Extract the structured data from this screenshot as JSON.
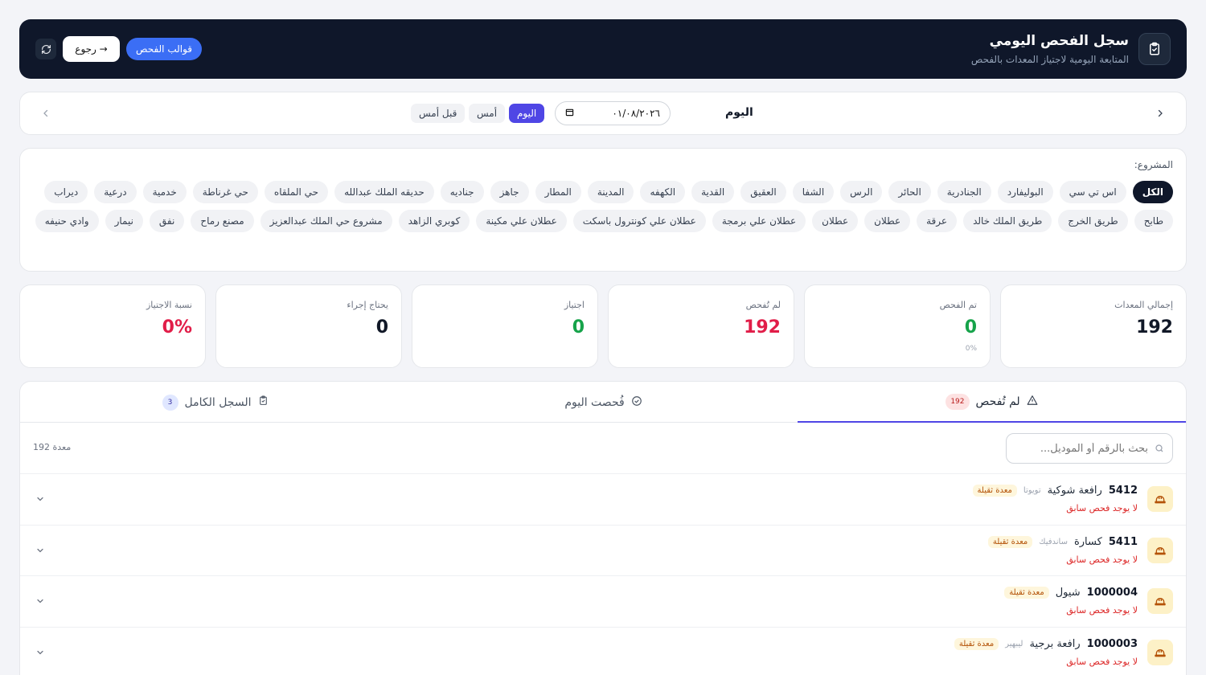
{
  "header": {
    "title": "سجل الفحص اليومي",
    "subtitle": "المتابعة اليومية لاجتياز المعدات بالفحص",
    "templates_label": "قوالب الفحص",
    "back_label": "→ رجوع"
  },
  "datebar": {
    "day_label": "اليوم",
    "date_value": "٠١/٠٨/٢٠٢٦",
    "quick": {
      "today": "اليوم",
      "yesterday": "أمس",
      "day_before": "قبل أمس"
    }
  },
  "projects": {
    "label": "المشروع:",
    "items": [
      "الكل",
      "اس تي سي",
      "البوليفارد",
      "الجنادرية",
      "الحائر",
      "الرس",
      "الشفا",
      "العقيق",
      "القدية",
      "الكهفه",
      "المدينة",
      "المطار",
      "جاهز",
      "جناديه",
      "حديقه الملك عبدالله",
      "حي الملقاه",
      "حي غرناطة",
      "خدمية",
      "درعية",
      "ديراب",
      "طابح",
      "طريق الخرج",
      "طريق الملك خالد",
      "عرقة",
      "عطلان",
      "عطلان",
      "عطلان علي برمجة",
      "عطلان علي كونترول باسكت",
      "عطلان علي مكينة",
      "كوبري الزاهد",
      "مشروع حي الملك عبدالعزيز",
      "مصنع رماح",
      "نفق",
      "نيمار",
      "وادي حنيفه"
    ]
  },
  "stats": [
    {
      "label": "إجمالي المعدات",
      "value": "192",
      "color": "#111827"
    },
    {
      "label": "تم الفحص",
      "value": "0",
      "sub": "0%",
      "color": "#16a34a"
    },
    {
      "label": "لم تُفحص",
      "value": "192",
      "color": "#e11d48"
    },
    {
      "label": "اجتياز",
      "value": "0",
      "color": "#16a34a"
    },
    {
      "label": "يحتاج إجراء",
      "value": "0",
      "color": "#111827"
    },
    {
      "label": "نسبة الاجتياز",
      "value": "0%",
      "color": "#e11d48"
    }
  ],
  "tabs": [
    {
      "label": "لم تُفحص",
      "badge": "192"
    },
    {
      "label": "فُحصت اليوم"
    },
    {
      "label": "السجل الكامل",
      "badge": "3"
    }
  ],
  "search": {
    "placeholder": "بحث بالرقم أو الموديل..."
  },
  "count_label": "192 معدة",
  "rows": [
    {
      "code": "5412",
      "name": "رافعة شوكية",
      "brand": "تويوتا",
      "tag": "معدة ثقيلة",
      "status": "لا يوجد فحص سابق"
    },
    {
      "code": "5411",
      "name": "كسارة",
      "brand": "ساندفيك",
      "tag": "معدة ثقيلة",
      "status": "لا يوجد فحص سابق"
    },
    {
      "code": "1000004",
      "name": "شيول",
      "brand": "",
      "tag": "معدة ثقيلة",
      "status": "لا يوجد فحص سابق"
    },
    {
      "code": "1000003",
      "name": "رافعة برجية",
      "brand": "ليبهير",
      "tag": "معدة ثقيلة",
      "status": "لا يوجد فحص سابق"
    }
  ]
}
